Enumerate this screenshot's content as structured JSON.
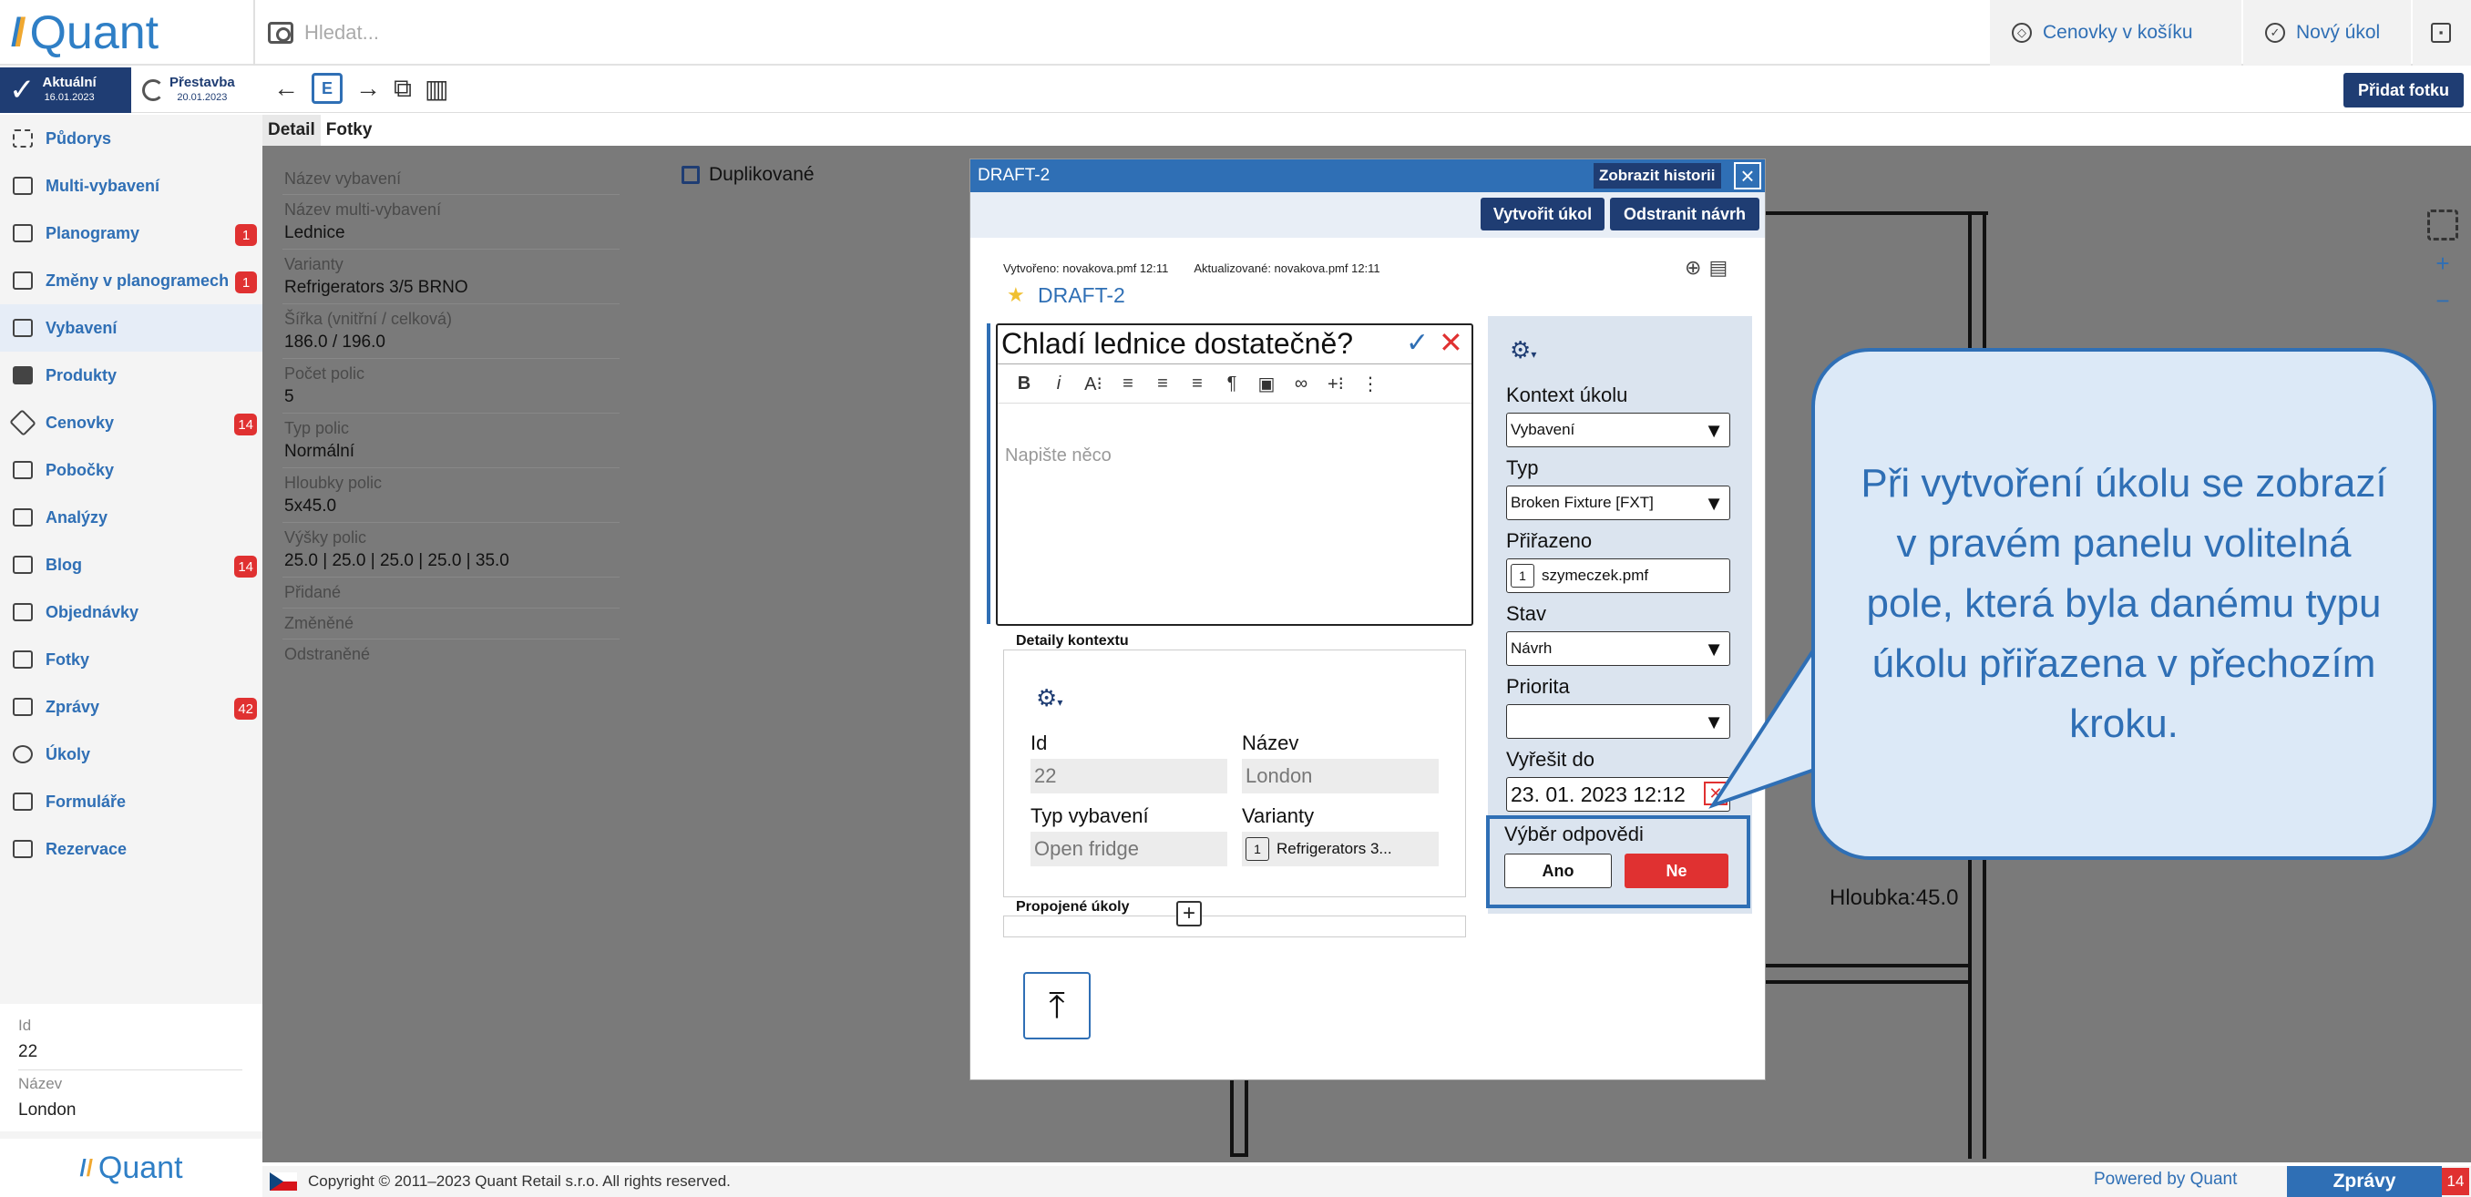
{
  "app": {
    "logo_text": "Quant"
  },
  "search": {
    "placeholder": "Hledat..."
  },
  "top_actions": [
    {
      "label": "Cenovky v košíku",
      "icon": "tag-icon"
    },
    {
      "label": "Nový úkol",
      "icon": "check-circle-icon"
    }
  ],
  "versions": {
    "active": {
      "label": "Aktuální",
      "date": "16.01.2023"
    },
    "other": {
      "label": "Přestavba",
      "date": "20.01.2023"
    }
  },
  "toolbar": {
    "add_photo": "Přidat fotku",
    "edit_badge": "E"
  },
  "sidebar": {
    "items": [
      {
        "label": "Půdorys",
        "badge": ""
      },
      {
        "label": "Multi-vybavení",
        "badge": ""
      },
      {
        "label": "Planogramy",
        "badge": "1"
      },
      {
        "label": "Změny v planogramech",
        "badge": "1"
      },
      {
        "label": "Vybavení",
        "badge": ""
      },
      {
        "label": "Produkty",
        "badge": ""
      },
      {
        "label": "Cenovky",
        "badge": "14"
      },
      {
        "label": "Pobočky",
        "badge": ""
      },
      {
        "label": "Analýzy",
        "badge": ""
      },
      {
        "label": "Blog",
        "badge": "14"
      },
      {
        "label": "Objednávky",
        "badge": ""
      },
      {
        "label": "Fotky",
        "badge": ""
      },
      {
        "label": "Zprávy",
        "badge": "42"
      },
      {
        "label": "Úkoly",
        "badge": ""
      },
      {
        "label": "Formuláře",
        "badge": ""
      },
      {
        "label": "Rezervace",
        "badge": ""
      }
    ],
    "info": {
      "id_label": "Id",
      "id_value": "22",
      "name_label": "Název",
      "name_value": "London"
    },
    "footer_logo": "Quant"
  },
  "tabs": [
    "Detail",
    "Fotky"
  ],
  "detail": {
    "rows": [
      {
        "label": "Název vybavení",
        "value": ""
      },
      {
        "label": "Název multi-vybavení",
        "value": "Lednice"
      },
      {
        "label": "Varianty",
        "value": "Refrigerators 3/5 BRNO"
      },
      {
        "label": "Šířka (vnitřní / celková)",
        "value": "186.0 / 196.0"
      },
      {
        "label": "Počet polic",
        "value": "5"
      },
      {
        "label": "Typ polic",
        "value": "Normální"
      },
      {
        "label": "Hloubky polic",
        "value": "5x45.0"
      },
      {
        "label": "Výšky polic",
        "value": "25.0 | 25.0 | 25.0 | 25.0 | 35.0"
      },
      {
        "label": "Přidané",
        "value": ""
      },
      {
        "label": "Změněné",
        "value": ""
      },
      {
        "label": "Odstraněné",
        "value": ""
      }
    ],
    "duplicated_label": "Duplikované"
  },
  "canvas": {
    "depth_label": "Hloubka:45.0",
    "zoom_in": "+",
    "zoom_out": "−"
  },
  "dialog": {
    "title": "DRAFT-2",
    "history_button": "Zobrazit historii",
    "create_task_button": "Vytvořit úkol",
    "delete_draft_button": "Odstranit návrh",
    "created": "Vytvořeno: novakova.pmf 12:11",
    "updated": "Aktualizované: novakova.pmf 12:11",
    "draft_name": "DRAFT-2",
    "task_title": "Chladí lednice dostatečně?",
    "editor_placeholder": "Napište něco",
    "context": {
      "title": "Detaily kontextu",
      "id_label": "Id",
      "id_value": "22",
      "name_label": "Název",
      "name_value": "London",
      "equip_type_label": "Typ vybavení",
      "equip_type_value": "Open fridge",
      "variants_label": "Varianty",
      "variants_count": "1",
      "variants_value": "Refrigerators 3..."
    },
    "linked_tasks": "Propojené úkoly",
    "right": {
      "task_context_label": "Kontext úkolu",
      "task_context_value": "Vybavení",
      "type_label": "Typ",
      "type_value": "Broken Fixture [FXT]",
      "assigned_label": "Přiřazeno",
      "assigned_count": "1",
      "assigned_value": "szymeczek.pmf",
      "state_label": "Stav",
      "state_value": "Návrh",
      "priority_label": "Priorita",
      "priority_value": "",
      "due_label": "Vyřešit do",
      "due_value": "23. 01. 2023 12:12",
      "answer_label": "Výběr odpovědi",
      "yes": "Ano",
      "no": "Ne"
    }
  },
  "callout": "Při vytvoření úkolu se zobrazí v pravém panelu volitelná pole, která byla danému typu úkolu přiřazena v přechozím kroku.",
  "footer": {
    "copyright": "Copyright © 2011–2023 Quant Retail s.r.o. All rights reserved.",
    "powered": "Powered by Quant",
    "messages": "Zprávy",
    "messages_count": "14"
  },
  "colors": {
    "primary": "#2f6fb5",
    "dark": "#1f3d73",
    "danger": "#e03131"
  }
}
